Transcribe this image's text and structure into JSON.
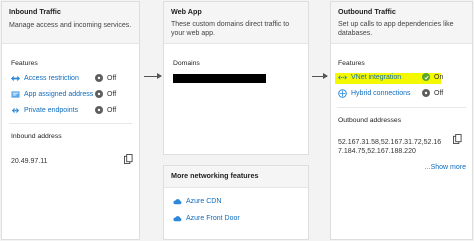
{
  "inbound": {
    "title": "Inbound Traffic",
    "description": "Manage access and incoming services.",
    "features_label": "Features",
    "features": [
      {
        "label": "Access restriction",
        "status": "Off"
      },
      {
        "label": "App assigned address",
        "status": "Off"
      },
      {
        "label": "Private endpoints",
        "status": "Off"
      }
    ],
    "address_label": "Inbound address",
    "address_value": "20.49.97.11"
  },
  "webapp": {
    "title": "Web App",
    "description": "These custom domains direct traffic to your web app.",
    "domains_label": "Domains"
  },
  "networking": {
    "title": "More networking features",
    "items": [
      {
        "label": "Azure CDN"
      },
      {
        "label": "Azure Front Door"
      }
    ]
  },
  "outbound": {
    "title": "Outbound Traffic",
    "description": "Set up calls to app dependencies like databases.",
    "features_label": "Features",
    "features": [
      {
        "label": "VNet integration",
        "status": "On"
      },
      {
        "label": "Hybrid connections",
        "status": "Off"
      }
    ],
    "addresses_label": "Outbound addresses",
    "addresses_value": "52.167.31.58,52.167.31.72,52.167.184.75,52.167.188.220",
    "show_more": "...Show more"
  },
  "colors": {
    "link": "#0f6cbd",
    "on": "#5aa52f",
    "off": "#605e5c",
    "highlight": "#f4f900"
  }
}
